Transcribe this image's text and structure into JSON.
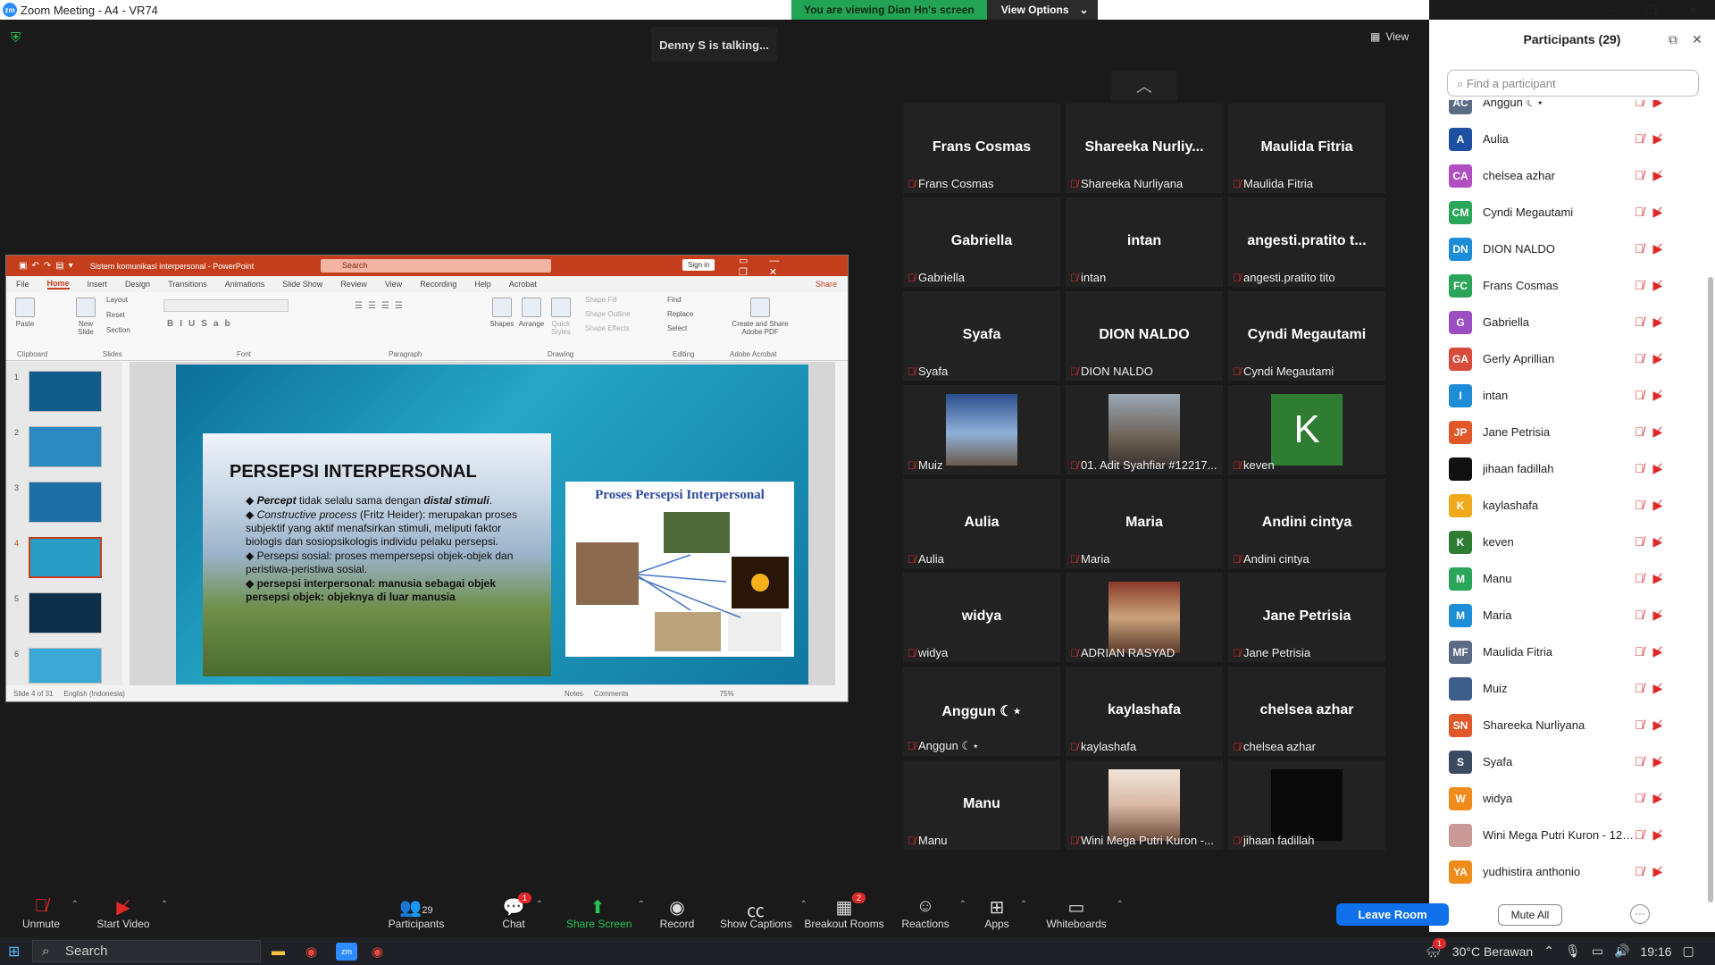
{
  "window": {
    "title": "Zoom Meeting - A4 - VR74",
    "min": "—",
    "max": "❐",
    "close": "✕"
  },
  "banner": {
    "viewing": "You are viewing Dian Hn's screen",
    "options": "View Options",
    "chevron": "⌄"
  },
  "talking": "Denny S is talking...",
  "view_btn": "View",
  "ppt": {
    "title": "Sistem komunikasi interpersonal - PowerPoint",
    "search": "Search",
    "signin": "Sign in",
    "share": "Share",
    "menu": [
      "File",
      "Home",
      "Insert",
      "Design",
      "Transitions",
      "Animations",
      "Slide Show",
      "Review",
      "View",
      "Recording",
      "Help",
      "Acrobat"
    ],
    "ribbon": {
      "paste": "Paste",
      "new_slide": "New Slide",
      "layout": "Layout",
      "reset": "Reset",
      "section": "Section",
      "find": "Find",
      "replace": "Replace",
      "select": "Select",
      "shapes": "Shapes",
      "arrange": "Arrange",
      "quick": "Quick Styles",
      "shape_fill": "Shape Fill",
      "shape_outline": "Shape Outline",
      "shape_effects": "Shape Effects",
      "acrobat_btn": "Create and Share Adobe PDF",
      "groups": [
        "Clipboard",
        "Slides",
        "Font",
        "Paragraph",
        "Drawing",
        "Editing",
        "Adobe Acrobat"
      ]
    },
    "thumb_nums": [
      "1",
      "2",
      "3",
      "4",
      "5",
      "6"
    ],
    "slide": {
      "heading": "PERSEPSI INTERPERSONAL",
      "b1_em": "Percept",
      "b1": " tidak selalu sama dengan ",
      "b1_em2": "distal stimuli",
      "b2_em": "Constructive process",
      "b2": " (Fritz Heider): merupakan proses subjektif yang aktif menafsirkan stimuli, meliputi faktor biologis dan sosiopsikologis individu pelaku persepsi.",
      "b3": "Persepsi sosial: proses mempersepsi objek-objek dan peristiwa-peristiwa sosial.",
      "b4": "persepsi interpersonal: manusia sebagai objek persepsi objek: objeknya di luar manusia",
      "right_title": "Proses Persepsi Interpersonal"
    },
    "status": {
      "slide": "Slide 4 of 31",
      "lang": "English (Indonesia)",
      "notes": "Notes",
      "comments": "Comments",
      "zoom": "75%"
    }
  },
  "tiles": [
    [
      "Frans Cosmas",
      "Frans Cosmas"
    ],
    [
      "Shareeka Nurliy...",
      "Shareeka Nurliyana"
    ],
    [
      "Maulida Fitria",
      "Maulida Fitria"
    ],
    [
      "Gabriella",
      "Gabriella"
    ],
    [
      "intan",
      "intan"
    ],
    [
      "angesti.pratito t...",
      "angesti.pratito tito"
    ],
    [
      "Syafa",
      "Syafa"
    ],
    [
      "DION NALDO",
      "DION NALDO"
    ],
    [
      "Cyndi Megautami",
      "Cyndi Megautami"
    ],
    [
      "",
      "Muiz"
    ],
    [
      "",
      "01. Adit Syahfiar #12217..."
    ],
    [
      "",
      "keven"
    ],
    [
      "Aulia",
      "Aulia"
    ],
    [
      "Maria",
      "Maria"
    ],
    [
      "Andini cintya",
      "Andini cintya"
    ],
    [
      "widya",
      "widya"
    ],
    [
      "",
      "ADRIAN RASYAD"
    ],
    [
      "Jane Petrisia",
      "Jane Petrisia"
    ],
    [
      "Anggun ☾⋆",
      "Anggun ☾⋆"
    ],
    [
      "kaylashafa",
      "kaylashafa"
    ],
    [
      "chelsea azhar",
      "chelsea azhar"
    ],
    [
      "Manu",
      "Manu"
    ],
    [
      "",
      "Wini Mega Putri Kuron -..."
    ],
    [
      "",
      "jihaan fadillah"
    ]
  ],
  "tile_k": "K",
  "panel": {
    "title": "Participants (29)",
    "find": "Find a participant",
    "mute_all": "Mute All",
    "more": "···",
    "list": [
      {
        "i": "AC",
        "n": "Anggun ☾⋆",
        "c": "#5b6b85"
      },
      {
        "i": "A",
        "n": "Aulia",
        "c": "#1e4fa0"
      },
      {
        "i": "CA",
        "n": "chelsea azhar",
        "c": "#b04ec2"
      },
      {
        "i": "CM",
        "n": "Cyndi Megautami",
        "c": "#2aa65a"
      },
      {
        "i": "DN",
        "n": "DION NALDO",
        "c": "#1e8dd8"
      },
      {
        "i": "FC",
        "n": "Frans Cosmas",
        "c": "#2aa65a"
      },
      {
        "i": "G",
        "n": "Gabriella",
        "c": "#9b4ec2"
      },
      {
        "i": "GA",
        "n": "Gerly Aprillian",
        "c": "#d84c3c"
      },
      {
        "i": "I",
        "n": "intan",
        "c": "#1e8dd8"
      },
      {
        "i": "JP",
        "n": "Jane Petrisia",
        "c": "#e0572a"
      },
      {
        "i": "",
        "n": "jihaan fadillah",
        "c": "#111111"
      },
      {
        "i": "K",
        "n": "kaylashafa",
        "c": "#f0a81c"
      },
      {
        "i": "K",
        "n": "keven",
        "c": "#2e7d32"
      },
      {
        "i": "M",
        "n": "Manu",
        "c": "#2aa65a"
      },
      {
        "i": "M",
        "n": "Maria",
        "c": "#1e8dd8"
      },
      {
        "i": "MF",
        "n": "Maulida Fitria",
        "c": "#5b6b85"
      },
      {
        "i": "",
        "n": "Muiz",
        "c": "#3d5d8a"
      },
      {
        "i": "SN",
        "n": "Shareeka Nurliyana",
        "c": "#e0572a"
      },
      {
        "i": "S",
        "n": "Syafa",
        "c": "#3a4a60"
      },
      {
        "i": "W",
        "n": "widya",
        "c": "#f08c1c"
      },
      {
        "i": "",
        "n": "Wini Mega Putri Kuron - 12017...",
        "c": "#c99"
      },
      {
        "i": "YA",
        "n": "yudhistira anthonio",
        "c": "#f08c1c"
      }
    ]
  },
  "toolbar": {
    "unmute": "Unmute",
    "start_video": "Start Video",
    "participants": "Participants",
    "participants_count": "29",
    "chat": "Chat",
    "chat_badge": "1",
    "share": "Share Screen",
    "record": "Record",
    "captions": "Show Captions",
    "breakout": "Breakout Rooms",
    "breakout_badge": "2",
    "reactions": "Reactions",
    "apps": "Apps",
    "whiteboards": "Whiteboards",
    "leave": "Leave Room"
  },
  "taskbar": {
    "search": "Search",
    "weather": "30°C  Berawan",
    "weather_badge": "1",
    "time": "19:16"
  }
}
